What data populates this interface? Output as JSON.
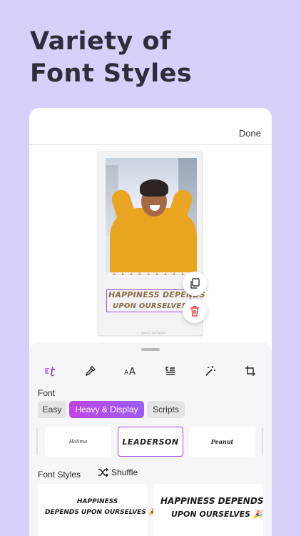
{
  "promo": {
    "title_line1": "Variety of",
    "title_line2": "Font Styles"
  },
  "editor": {
    "done_label": "Done",
    "poster": {
      "quote_line1": "HAPPINESS DEPENDS",
      "quote_line2": "UPON OURSELVES",
      "quote_emoji": "🎉",
      "handle": "@positivelyyou"
    }
  },
  "toolbar": {
    "tools": [
      {
        "name": "text-style-tool",
        "icon": "text-style-icon"
      },
      {
        "name": "color-picker-tool",
        "icon": "eyedropper-icon"
      },
      {
        "name": "font-size-tool",
        "icon": "font-size-icon",
        "glyph": "AA"
      },
      {
        "name": "alignment-tool",
        "icon": "text-align-icon"
      },
      {
        "name": "effects-tool",
        "icon": "magic-wand-icon"
      },
      {
        "name": "position-tool",
        "icon": "crop-move-icon"
      }
    ],
    "accent": "#9a4ddb"
  },
  "font_section": {
    "label": "Font",
    "categories": [
      {
        "label": "Easy",
        "active": false
      },
      {
        "label": "Heavy & Display",
        "active": true
      },
      {
        "label": "Scripts",
        "active": false
      }
    ],
    "fonts": [
      {
        "label": "Halima",
        "selected": false
      },
      {
        "label": "LEADERSON",
        "selected": true
      },
      {
        "label": "Peanut",
        "selected": false
      }
    ]
  },
  "styles_section": {
    "label": "Font Styles",
    "shuffle_label": "Shuffle",
    "cards": [
      {
        "line1": "HAPPINESS",
        "line2": "DEPENDS UPON OURSELVES 🎉"
      },
      {
        "line1": "HAPPINESS DEPENDS",
        "line2": "UPON OURSELVES 🎉"
      }
    ]
  }
}
